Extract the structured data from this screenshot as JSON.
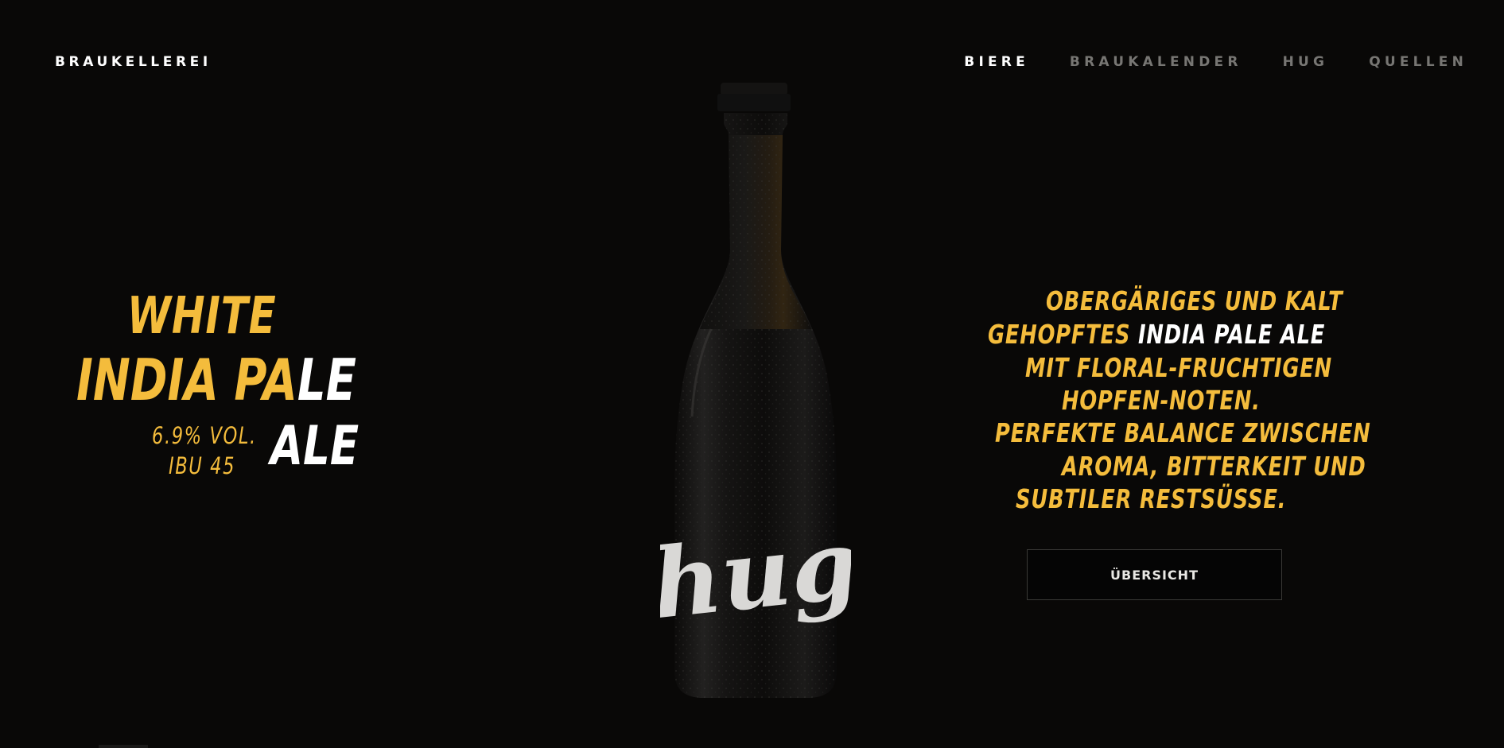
{
  "header": {
    "logo": "BRAUKELLEREI",
    "nav": [
      {
        "label": "BIERE",
        "active": true
      },
      {
        "label": "BRAUKALENDER",
        "active": false
      },
      {
        "label": "HUG",
        "active": false
      },
      {
        "label": "QUELLEN",
        "active": false
      }
    ]
  },
  "beer": {
    "name_line1": "WHITE",
    "name_line2_a": "INDIA ",
    "name_line2_b": "PA",
    "name_line2_c": "LE",
    "name_line3": "ALE",
    "abv": "6.9% VOL.",
    "ibu": "IBU 45",
    "bottle_label": "hug"
  },
  "description": {
    "line1": "OBERGÄRIGES UND KALT",
    "line2_a": "GEHOPFTES ",
    "line2_b": "INDIA PALE ALE",
    "line3": "MIT FLORAL-FRUCHTIGEN",
    "line4": "HOPFEN-NOTEN.",
    "line5": "PERFEKTE BALANCE ZWISCHEN",
    "line6": "AROMA, BITTERKEIT UND",
    "line7": "SUBTILER RESTSÜSSE."
  },
  "cta": {
    "label": "ÜBERSICHT"
  },
  "colors": {
    "background": "#090807",
    "accent": "#f4bc3c",
    "nav_inactive": "#777673",
    "text": "#ffffff"
  }
}
